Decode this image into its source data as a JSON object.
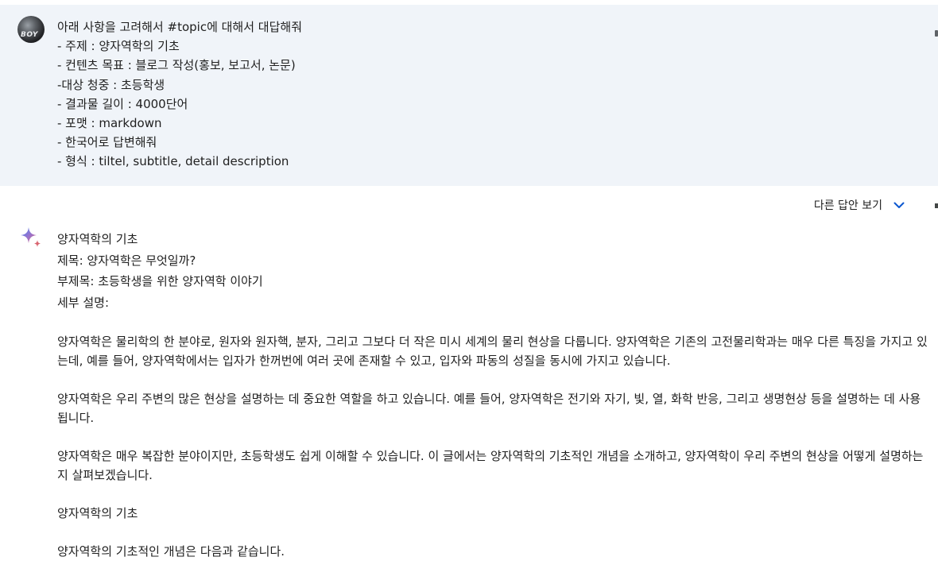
{
  "prompt": {
    "avatar_text": "BOY",
    "lines": [
      "아래 사항을 고려해서 #topic에 대해서 대답해줘",
      "- 주제 : 양자역학의 기초",
      "- 컨텐츠 목표 : 블로그 작성(홍보, 보고서, 논문)",
      "-대상 청중 : 초등학생",
      "- 결과물 길이 : 4000단어",
      "- 포맷 : markdown",
      "- 한국어로 답변해줘",
      "- 형식 : tiltel, subtitle, detail description"
    ]
  },
  "response": {
    "drafts_label": "다른 답안 보기",
    "heading": "양자역학의 기초",
    "title_line": "제목: 양자역학은 무엇일까?",
    "subtitle_line": "부제목: 초등학생을 위한 양자역학 이야기",
    "detail_label": "세부 설명:",
    "para1": "양자역학은 물리학의 한 분야로, 원자와 원자핵, 분자, 그리고 그보다 더 작은 미시 세계의 물리 현상을 다룹니다. 양자역학은 기존의 고전물리학과는 매우 다른 특징을 가지고 있는데, 예를 들어, 양자역학에서는 입자가 한꺼번에 여러 곳에 존재할 수 있고, 입자와 파동의 성질을 동시에 가지고 있습니다.",
    "para2": "양자역학은 우리 주변의 많은 현상을 설명하는 데 중요한 역할을 하고 있습니다. 예를 들어, 양자역학은 전기와 자기, 빛, 열, 화학 반응, 그리고 생명현상 등을 설명하는 데 사용됩니다.",
    "para3": "양자역학은 매우 복잡한 분야이지만, 초등학생도 쉽게 이해할 수 있습니다. 이 글에서는 양자역학의 기초적인 개념을 소개하고, 양자역학이 우리 주변의 현상을 어떻게 설명하는지 살펴보겠습니다.",
    "section_heading": "양자역학의 기초",
    "para4": "양자역학의 기초적인 개념은 다음과 같습니다."
  },
  "colors": {
    "prompt_bg": "#f0f4f9",
    "chevron": "#0b57d0",
    "sparkle_blue": "#4285f4",
    "sparkle_purple": "#9b72cb",
    "sparkle_red": "#d96570"
  }
}
